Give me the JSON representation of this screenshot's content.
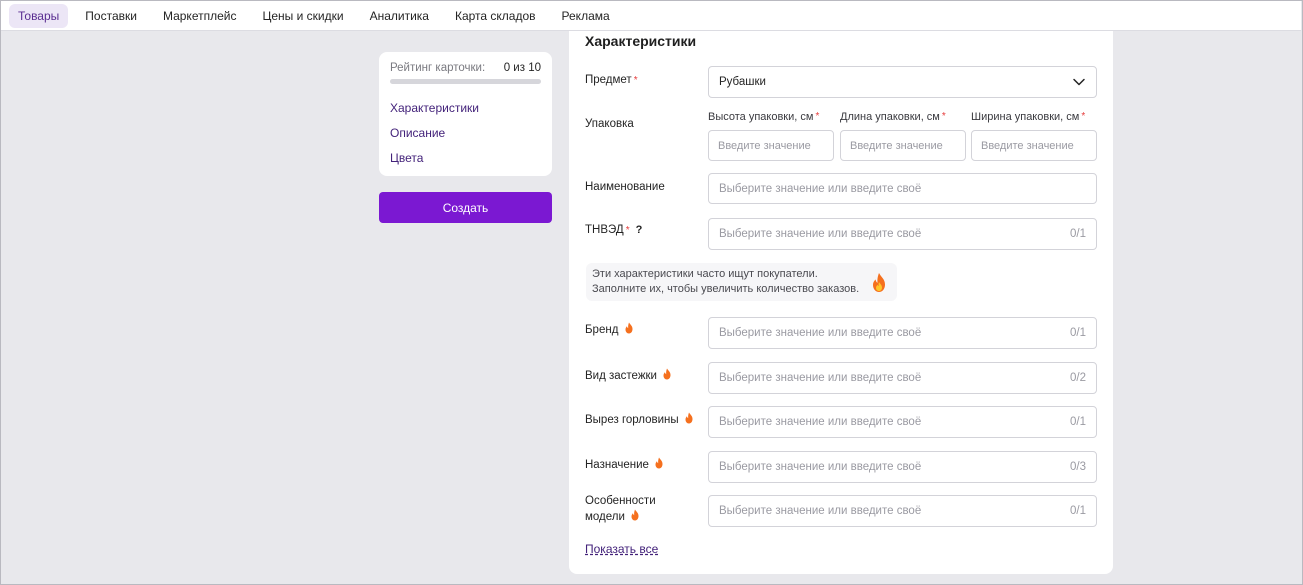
{
  "nav": {
    "items": [
      "Товары",
      "Поставки",
      "Маркетплейс",
      "Цены и скидки",
      "Аналитика",
      "Карта складов",
      "Реклама"
    ],
    "active_index": 0
  },
  "left": {
    "rating_label": "Рейтинг карточки:",
    "rating_value": "0 из 10",
    "rating_fraction": 0,
    "links": [
      "Характеристики",
      "Описание",
      "Цвета"
    ],
    "create_label": "Создать"
  },
  "main": {
    "title": "Характеристики",
    "subject_label": "Предмет",
    "subject_value": "Рубашки",
    "package_label": "Упаковка",
    "package_fields": [
      {
        "label": "Высота упаковки, см",
        "placeholder": "Введите значение"
      },
      {
        "label": "Длина упаковки, см",
        "placeholder": "Введите значение"
      },
      {
        "label": "Ширина упаковки, см",
        "placeholder": "Введите значение"
      }
    ],
    "name_label": "Наименование",
    "name_placeholder": "Выберите значение или введите своё",
    "tnved_label": "ТНВЭД",
    "tnved_help": "?",
    "tnved_placeholder": "Выберите значение или введите своё",
    "tnved_count": "0/1",
    "hint_line1": "Эти характеристики часто ищут покупатели.",
    "hint_line2": "Заполните их, чтобы увеличить количество заказов.",
    "popular_fields": [
      {
        "label": "Бренд",
        "placeholder": "Выберите значение или введите своё",
        "count": "0/1"
      },
      {
        "label": "Вид застежки",
        "placeholder": "Выберите значение или введите своё",
        "count": "0/2"
      },
      {
        "label": "Вырез горловины",
        "placeholder": "Выберите значение или введите своё",
        "count": "0/1"
      },
      {
        "label": "Назначение",
        "placeholder": "Выберите значение или введите своё",
        "count": "0/3"
      },
      {
        "label_line1": "Особенности",
        "label_line2": "модели",
        "placeholder": "Выберите значение или введите своё",
        "count": "0/1"
      }
    ],
    "show_all": "Показать все",
    "required_mark": "*"
  },
  "colors": {
    "accent": "#7b18d2",
    "link": "#43227a",
    "required": "#e63b3b",
    "fire": "#f26b1d"
  },
  "icons": {
    "select": "chevron-down-icon",
    "popular": "fire-icon"
  }
}
